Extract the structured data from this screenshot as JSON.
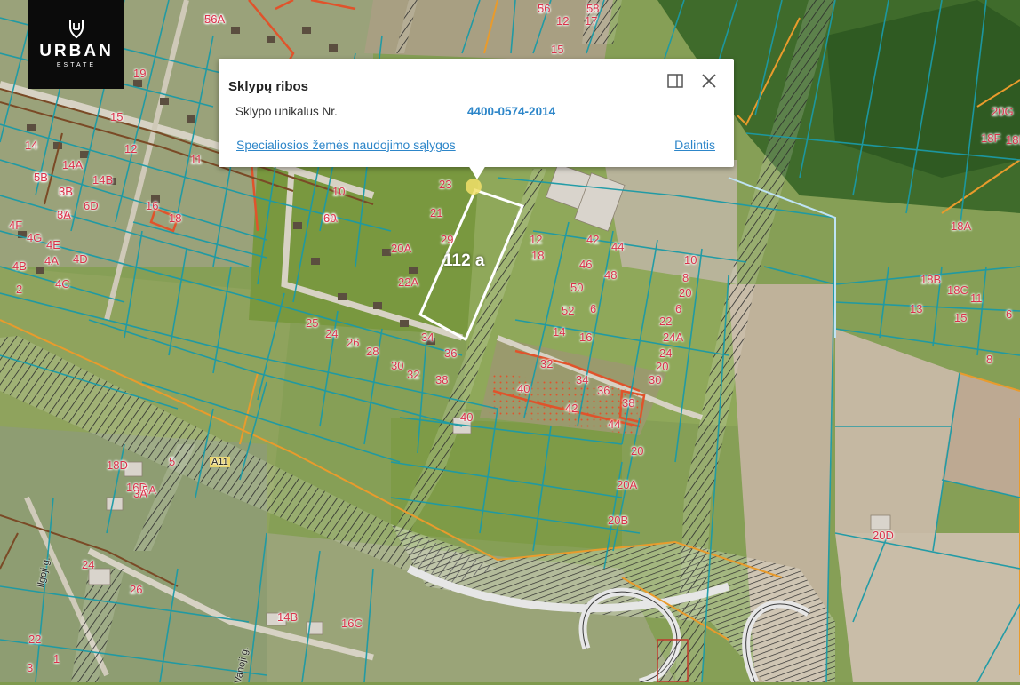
{
  "brand": {
    "name": "URBAN",
    "subtitle": "ESTATE"
  },
  "popup": {
    "title": "Sklypų ribos",
    "field_label": "Sklypo unikalus Nr.",
    "field_value": "4400-0574-2014",
    "link_left": "Specialiosios žemės naudojimo sąlygos",
    "link_right": "Dalintis"
  },
  "map": {
    "area_label": "112 a",
    "road_labels": [
      "Ilgoji g.",
      "Vanoji g.",
      "A11"
    ],
    "parcel_numbers": [
      "3",
      "1",
      "20A",
      "6A",
      "6B",
      "6C",
      "6E",
      "6D",
      "4F",
      "4G",
      "4E",
      "4B",
      "4A",
      "4D",
      "2",
      "4C",
      "14",
      "14A",
      "14B",
      "16",
      "18",
      "19",
      "15",
      "12",
      "11",
      "10",
      "9",
      "22A",
      "20A",
      "23",
      "21",
      "29",
      "25",
      "24",
      "26",
      "28",
      "30",
      "32",
      "34",
      "36",
      "38",
      "40",
      "42",
      "44",
      "46",
      "48",
      "50",
      "52",
      "6",
      "14",
      "16",
      "12",
      "18",
      "10",
      "8",
      "20",
      "6",
      "22",
      "24A",
      "24",
      "20",
      "30",
      "32",
      "34",
      "36",
      "38",
      "40",
      "42",
      "44",
      "20",
      "20A",
      "20B",
      "20D",
      "18A",
      "18B",
      "18C",
      "11",
      "13",
      "15",
      "8",
      "20G",
      "18F",
      "18E",
      "18D",
      "16D",
      "16C",
      "14B",
      "26",
      "24",
      "22",
      "1",
      "3",
      "5",
      "5A",
      "3A",
      "6",
      "15",
      "12",
      "17",
      "56",
      "58",
      "56A",
      "60",
      "5B",
      "3B",
      "3A"
    ],
    "colors": {
      "parcel_line": "#1b9aa6",
      "red_line": "#e0532b",
      "orange_line": "#e99b2c",
      "selected": "#ffffff",
      "label_red": "#d9324a",
      "link_blue": "#2d86c9"
    }
  }
}
